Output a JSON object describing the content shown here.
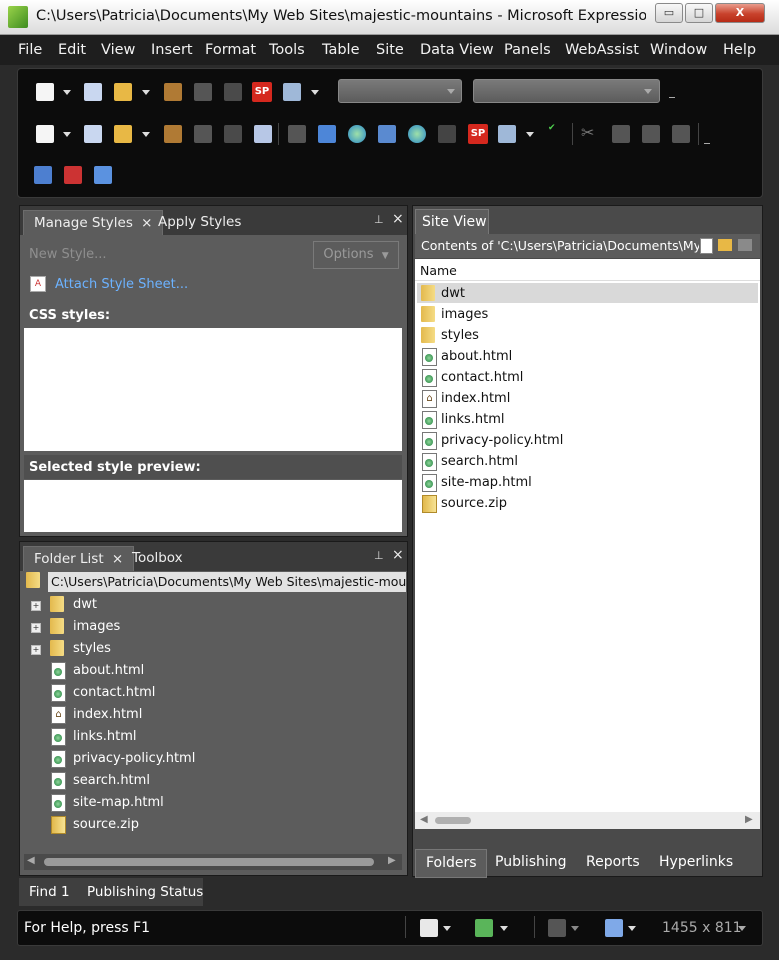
{
  "window": {
    "title": "C:\\Users\\Patricia\\Documents\\My Web Sites\\majestic-mountains - Microsoft Expression We...",
    "minimize": "▭",
    "maximize": "□",
    "close": "X"
  },
  "menu": [
    "File",
    "Edit",
    "View",
    "Insert",
    "Format",
    "Tools",
    "Table",
    "Site",
    "Data View",
    "Panels",
    "WebAssist",
    "Window",
    "Help"
  ],
  "manage_styles": {
    "tab_label": "Manage Styles",
    "tab_close": "×",
    "apply_tab": "Apply Styles",
    "pin": "📌",
    "close": "×",
    "new_style": "New Style...",
    "options": "Options",
    "attach": "Attach Style Sheet...",
    "css_styles": "CSS styles:",
    "preview": "Selected style preview:"
  },
  "folder_list": {
    "tab_label": "Folder List",
    "tab_close": "×",
    "toolbox_tab": "Toolbox",
    "pin": "📌",
    "close": "×",
    "root": "C:\\Users\\Patricia\\Documents\\My Web Sites\\majestic-mountains",
    "items": [
      {
        "name": "dwt",
        "type": "folder",
        "expand": "+"
      },
      {
        "name": "images",
        "type": "folder",
        "expand": "+"
      },
      {
        "name": "styles",
        "type": "folder",
        "expand": "+"
      },
      {
        "name": "about.html",
        "type": "page"
      },
      {
        "name": "contact.html",
        "type": "page"
      },
      {
        "name": "index.html",
        "type": "home"
      },
      {
        "name": "links.html",
        "type": "page"
      },
      {
        "name": "privacy-policy.html",
        "type": "page"
      },
      {
        "name": "search.html",
        "type": "page"
      },
      {
        "name": "site-map.html",
        "type": "page"
      },
      {
        "name": "source.zip",
        "type": "zip"
      }
    ]
  },
  "site_view": {
    "tab_label": "Site View",
    "contents": "Contents of 'C:\\Users\\Patricia\\Documents\\My ...",
    "column_name": "Name",
    "items": [
      "dwt",
      "images",
      "styles",
      "about.html",
      "contact.html",
      "index.html",
      "links.html",
      "privacy-policy.html",
      "search.html",
      "site-map.html",
      "source.zip"
    ],
    "bottom_tabs": [
      "Folders",
      "Publishing",
      "Reports",
      "Hyperlinks"
    ]
  },
  "bottom_tabs": [
    "Find 1",
    "Publishing Status"
  ],
  "status": {
    "help": "For Help, press F1",
    "dimensions": "1455 x 811"
  },
  "colors": {
    "accent": "#5fa0f0",
    "panel": "#5c5c5c",
    "dark": "#0c0c0c",
    "selection": "#d9d9d9"
  }
}
